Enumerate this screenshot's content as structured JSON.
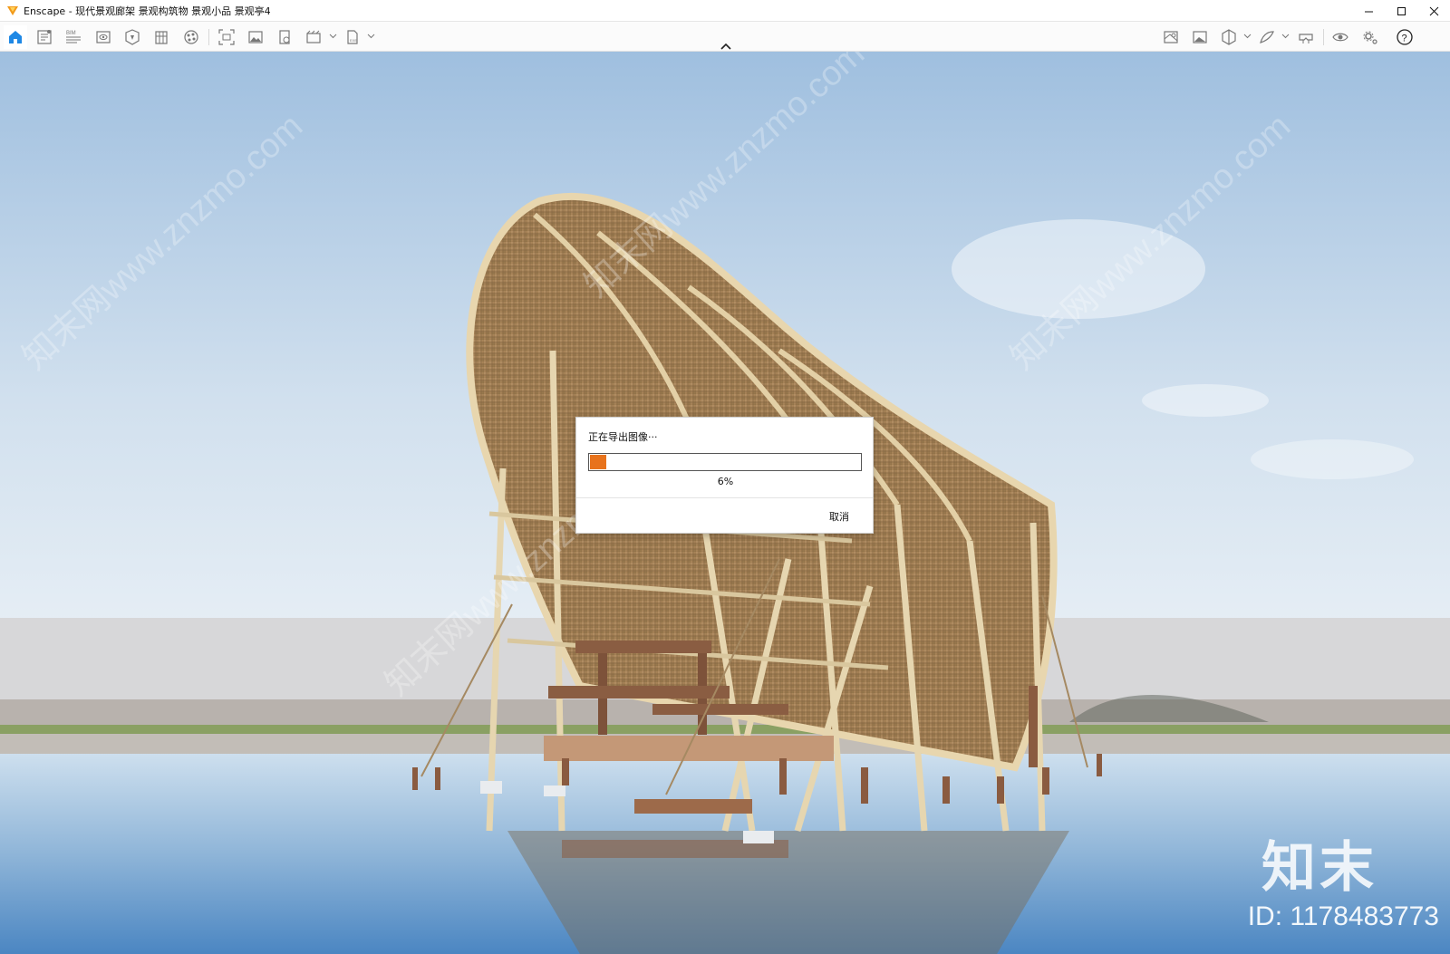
{
  "window": {
    "title": "Enscape - 现代景观廊架 景观构筑物 景观小品 景观亭4"
  },
  "toolbar": {
    "left_icons": [
      "home-icon",
      "document-icon",
      "bim-icon",
      "visual-settings-icon",
      "asset-library-icon",
      "views-icon",
      "materials-icon",
      "screenshot-icon",
      "image-icon",
      "batch-render-icon",
      "video-editor-icon",
      "export-icon"
    ],
    "right_icons": [
      "map-icon",
      "gallery-icon",
      "cube-icon",
      "sketch-icon",
      "vr-headset-icon",
      "preview-eye-icon",
      "settings-icon",
      "help-icon"
    ],
    "bim_label": "BIM",
    "help_label": "?"
  },
  "viewport": {
    "watermark_brand": "知末",
    "watermark_id": "ID: 1178483773",
    "watermark_site": "知末网www.znzmo.com"
  },
  "export_dialog": {
    "title": "正在导出图像···",
    "progress": 0.06,
    "progress_label": "6%",
    "cancel_label": "取消",
    "fill_color": "#e8731c"
  }
}
